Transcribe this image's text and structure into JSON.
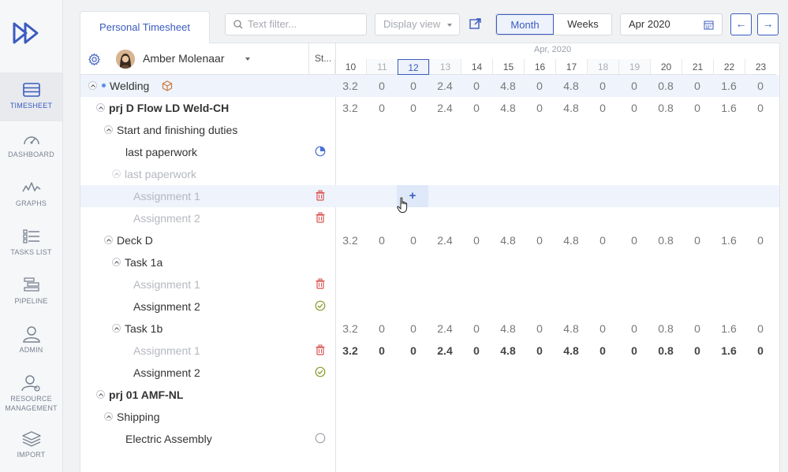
{
  "sidebar": {
    "items": [
      {
        "label": "TIMESHEET",
        "icon": "timesheet-icon",
        "active": true
      },
      {
        "label": "DASHBOARD",
        "icon": "dashboard-icon"
      },
      {
        "label": "GRAPHS",
        "icon": "graphs-icon"
      },
      {
        "label": "TASKS LIST",
        "icon": "tasks-list-icon"
      },
      {
        "label": "PIPELINE",
        "icon": "pipeline-icon"
      },
      {
        "label": "ADMIN",
        "icon": "admin-icon"
      },
      {
        "label": "RESOURCE",
        "label2": "MANAGEMENT",
        "icon": "resource-management-icon"
      },
      {
        "label": "IMPORT",
        "icon": "import-icon"
      }
    ]
  },
  "toolbar": {
    "tab_label": "Personal Timesheet",
    "filter_placeholder": "Text filter...",
    "display_view": "Display view",
    "month_label": "Month",
    "weeks_label": "Weeks",
    "date_value": "Apr 2020",
    "prev_label": "←",
    "next_label": "→"
  },
  "grid": {
    "user_name": "Amber Molenaar",
    "status_header": "St...",
    "month_label": "Apr, 2020",
    "days": [
      "10",
      "11",
      "12",
      "13",
      "14",
      "15",
      "16",
      "17",
      "18",
      "19",
      "20",
      "21",
      "22",
      "23"
    ],
    "weekend_days": [
      "11",
      "13",
      "18",
      "19"
    ],
    "today": "12",
    "rows": [
      {
        "label": "Welding",
        "indent": 1,
        "dot": true,
        "icon": "package-icon",
        "values": [
          "3.2",
          "0",
          "0",
          "2.4",
          "0",
          "4.8",
          "0",
          "4.8",
          "0",
          "0",
          "0.8",
          "0",
          "1.6",
          "0"
        ],
        "highlight": true
      },
      {
        "label": "prj D Flow LD Weld-CH",
        "indent": 2,
        "bold": true,
        "values": [
          "3.2",
          "0",
          "0",
          "2.4",
          "0",
          "4.8",
          "0",
          "4.8",
          "0",
          "0",
          "0.8",
          "0",
          "1.6",
          "0"
        ]
      },
      {
        "label": "Start and finishing duties",
        "indent": 3
      },
      {
        "label": "last paperwork",
        "indent": 4,
        "status": "pie-chart-icon"
      },
      {
        "label": "last paperwork",
        "indent": 4,
        "dim": true,
        "toggle": true
      },
      {
        "label": "Assignment 1",
        "indent": 5,
        "dim": true,
        "status": "trash-icon",
        "highlight": true,
        "plus": true
      },
      {
        "label": "Assignment 2",
        "indent": 5,
        "dim": true,
        "status": "trash-icon"
      },
      {
        "label": "Deck D",
        "indent": 3,
        "values": [
          "3.2",
          "0",
          "0",
          "2.4",
          "0",
          "4.8",
          "0",
          "4.8",
          "0",
          "0",
          "0.8",
          "0",
          "1.6",
          "0"
        ]
      },
      {
        "label": "Task 1a",
        "indent": 4,
        "toggle": true
      },
      {
        "label": "Assignment 1",
        "indent": 5,
        "dim": true,
        "status": "trash-icon"
      },
      {
        "label": "Assignment 2",
        "indent": 5,
        "status": "check-circle-icon"
      },
      {
        "label": "Task 1b",
        "indent": 4,
        "toggle": true,
        "values": [
          "3.2",
          "0",
          "0",
          "2.4",
          "0",
          "4.8",
          "0",
          "4.8",
          "0",
          "0",
          "0.8",
          "0",
          "1.6",
          "0"
        ]
      },
      {
        "label": "Assignment 1",
        "indent": 5,
        "dim": true,
        "status": "trash-icon",
        "bold_values": true,
        "values": [
          "3.2",
          "0",
          "0",
          "2.4",
          "0",
          "4.8",
          "0",
          "4.8",
          "0",
          "0",
          "0.8",
          "0",
          "1.6",
          "0"
        ]
      },
      {
        "label": "Assignment 2",
        "indent": 5,
        "status": "check-circle-icon"
      },
      {
        "label": "prj 01 AMF-NL",
        "indent": 2,
        "bold": true
      },
      {
        "label": "Shipping",
        "indent": 3
      },
      {
        "label": "Electric Assembly",
        "indent": 4,
        "status": "empty-circle-icon"
      }
    ],
    "plus_label": "+"
  },
  "colors": {
    "accent": "#3b5bbf",
    "danger": "#d9534f",
    "success": "#8a9a2a"
  }
}
